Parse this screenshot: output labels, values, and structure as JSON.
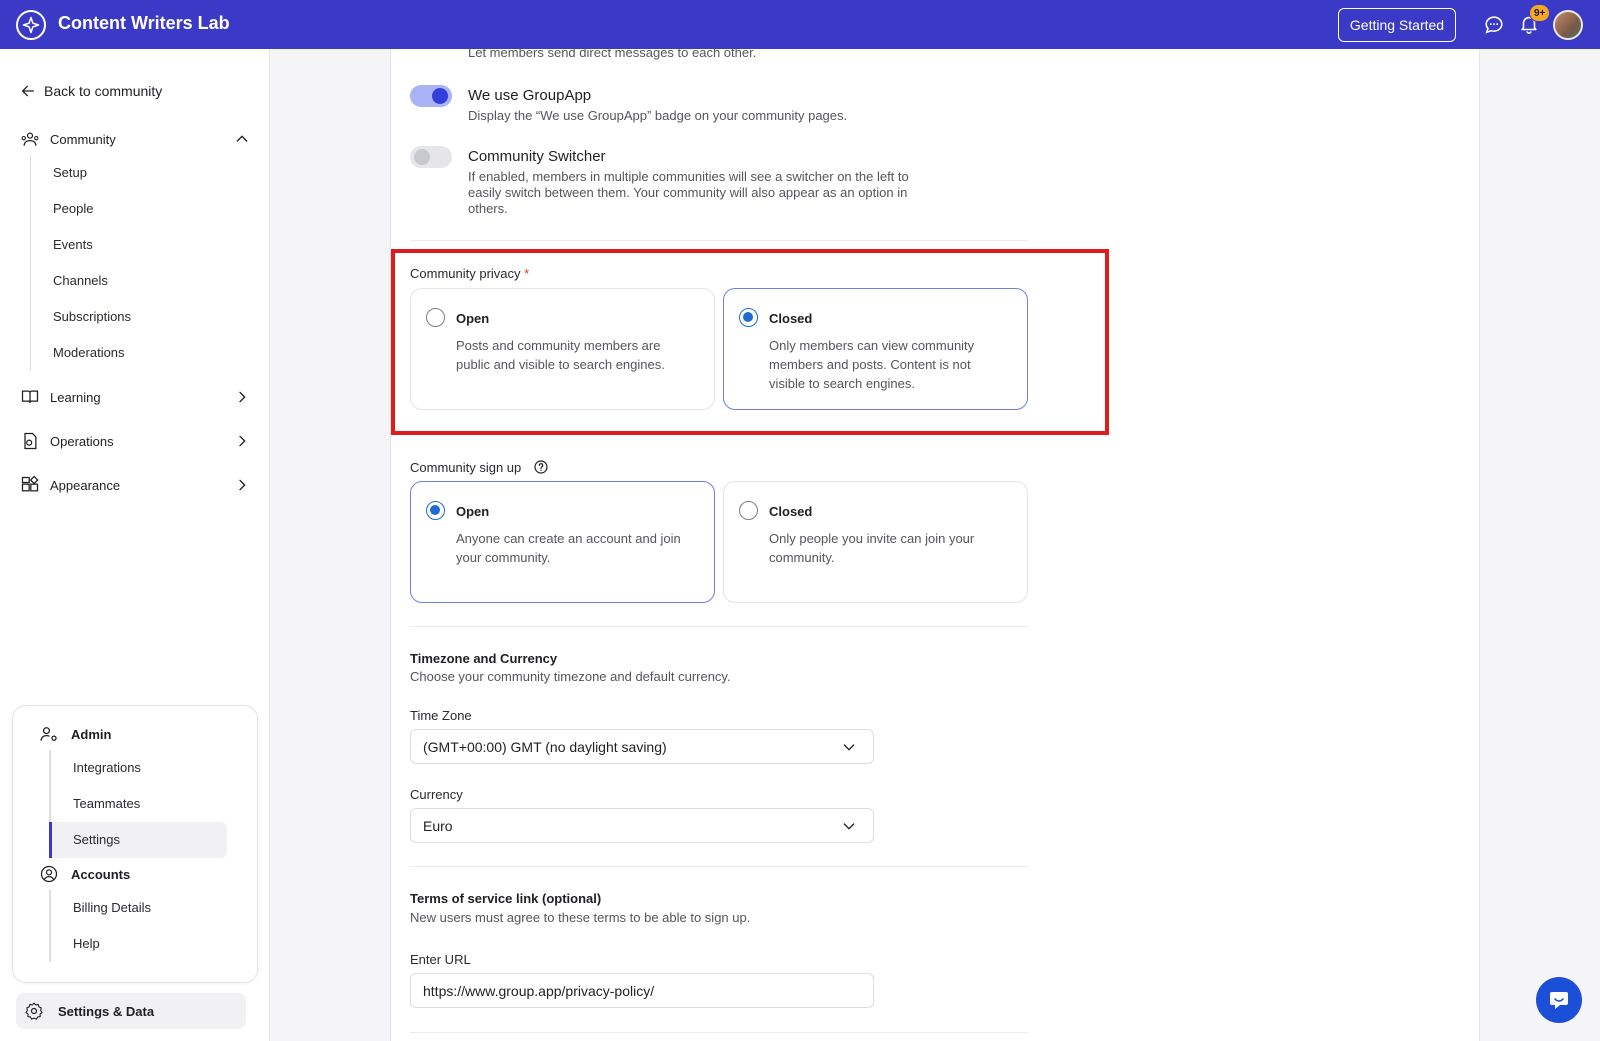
{
  "topbar": {
    "brand_name": "Content Writers Lab",
    "getting_started_label": "Getting Started",
    "notification_count": "9+",
    "accent_color": "#3b3ac7"
  },
  "sidebar": {
    "back_label": "Back to community",
    "community": {
      "label": "Community",
      "items": [
        "Setup",
        "People",
        "Events",
        "Channels",
        "Subscriptions",
        "Moderations"
      ]
    },
    "learning_label": "Learning",
    "operations_label": "Operations",
    "appearance_label": "Appearance",
    "admin": {
      "label": "Admin",
      "items": [
        "Integrations",
        "Teammates",
        "Settings"
      ],
      "active_item": "Settings"
    },
    "accounts": {
      "label": "Accounts",
      "items": [
        "Billing Details",
        "Help"
      ]
    },
    "settings_data_label": "Settings & Data"
  },
  "main": {
    "cut_off_text": "Let members send direct messages to each other.",
    "groupapp_toggle": {
      "title": "We use GroupApp",
      "desc": "Display the “We use GroupApp” badge on your community pages.",
      "on": true
    },
    "switcher_toggle": {
      "title": "Community Switcher",
      "desc_line1": "If enabled, members in multiple communities will see a switcher on the left to",
      "desc_line2": "easily switch between them. Your community will also appear as an option in",
      "desc_line3": "others.",
      "on": false
    },
    "privacy": {
      "label": "Community privacy",
      "required_mark": "*",
      "open_title": "Open",
      "open_desc": "Posts and community members are public and visible to search engines.",
      "closed_title": "Closed",
      "closed_desc": "Only members can view community members and posts. Content is not visible to search engines.",
      "selected": "Closed"
    },
    "signup": {
      "label": "Community sign up",
      "open_title": "Open",
      "open_desc": "Anyone can create an account and join your community.",
      "closed_title": "Closed",
      "closed_desc": "Only people you invite can join your community.",
      "selected": "Open"
    },
    "timezone_section": {
      "title": "Timezone and Currency",
      "desc": "Choose your community timezone and default currency.",
      "timezone_label": "Time Zone",
      "timezone_value": "(GMT+00:00) GMT (no daylight saving)",
      "currency_label": "Currency",
      "currency_value": "Euro"
    },
    "terms_section": {
      "title": "Terms of service link (optional)",
      "desc": "New users must agree to these terms to be able to sign up.",
      "url_label": "Enter URL",
      "url_value": "https://www.group.app/privacy-policy/"
    }
  }
}
